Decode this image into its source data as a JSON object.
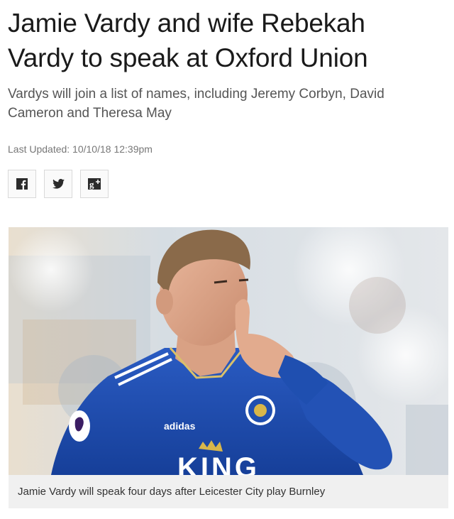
{
  "article": {
    "headline": "Jamie Vardy and wife Rebekah Vardy to speak at Oxford Union",
    "standfirst": "Vardys will join a list of names, including Jeremy Corbyn, David Cameron and Theresa May",
    "last_updated": "Last Updated: 10/10/18 12:39pm"
  },
  "share": {
    "buttons": [
      {
        "icon": "facebook-icon",
        "glyph": "f"
      },
      {
        "icon": "twitter-icon",
        "glyph": "bird"
      },
      {
        "icon": "google-plus-icon",
        "glyph": "g+"
      }
    ]
  },
  "figure": {
    "photo_kit_brand": "adidas",
    "photo_sponsor": "KING",
    "caption": "Jamie Vardy will speak four days after Leicester City play Burnley"
  },
  "colors": {
    "headline": "#1a1a1a",
    "standfirst": "#555555",
    "meta": "#777777",
    "kit_blue": "#1f4fb0",
    "caption_bg": "#f0f0f0"
  }
}
